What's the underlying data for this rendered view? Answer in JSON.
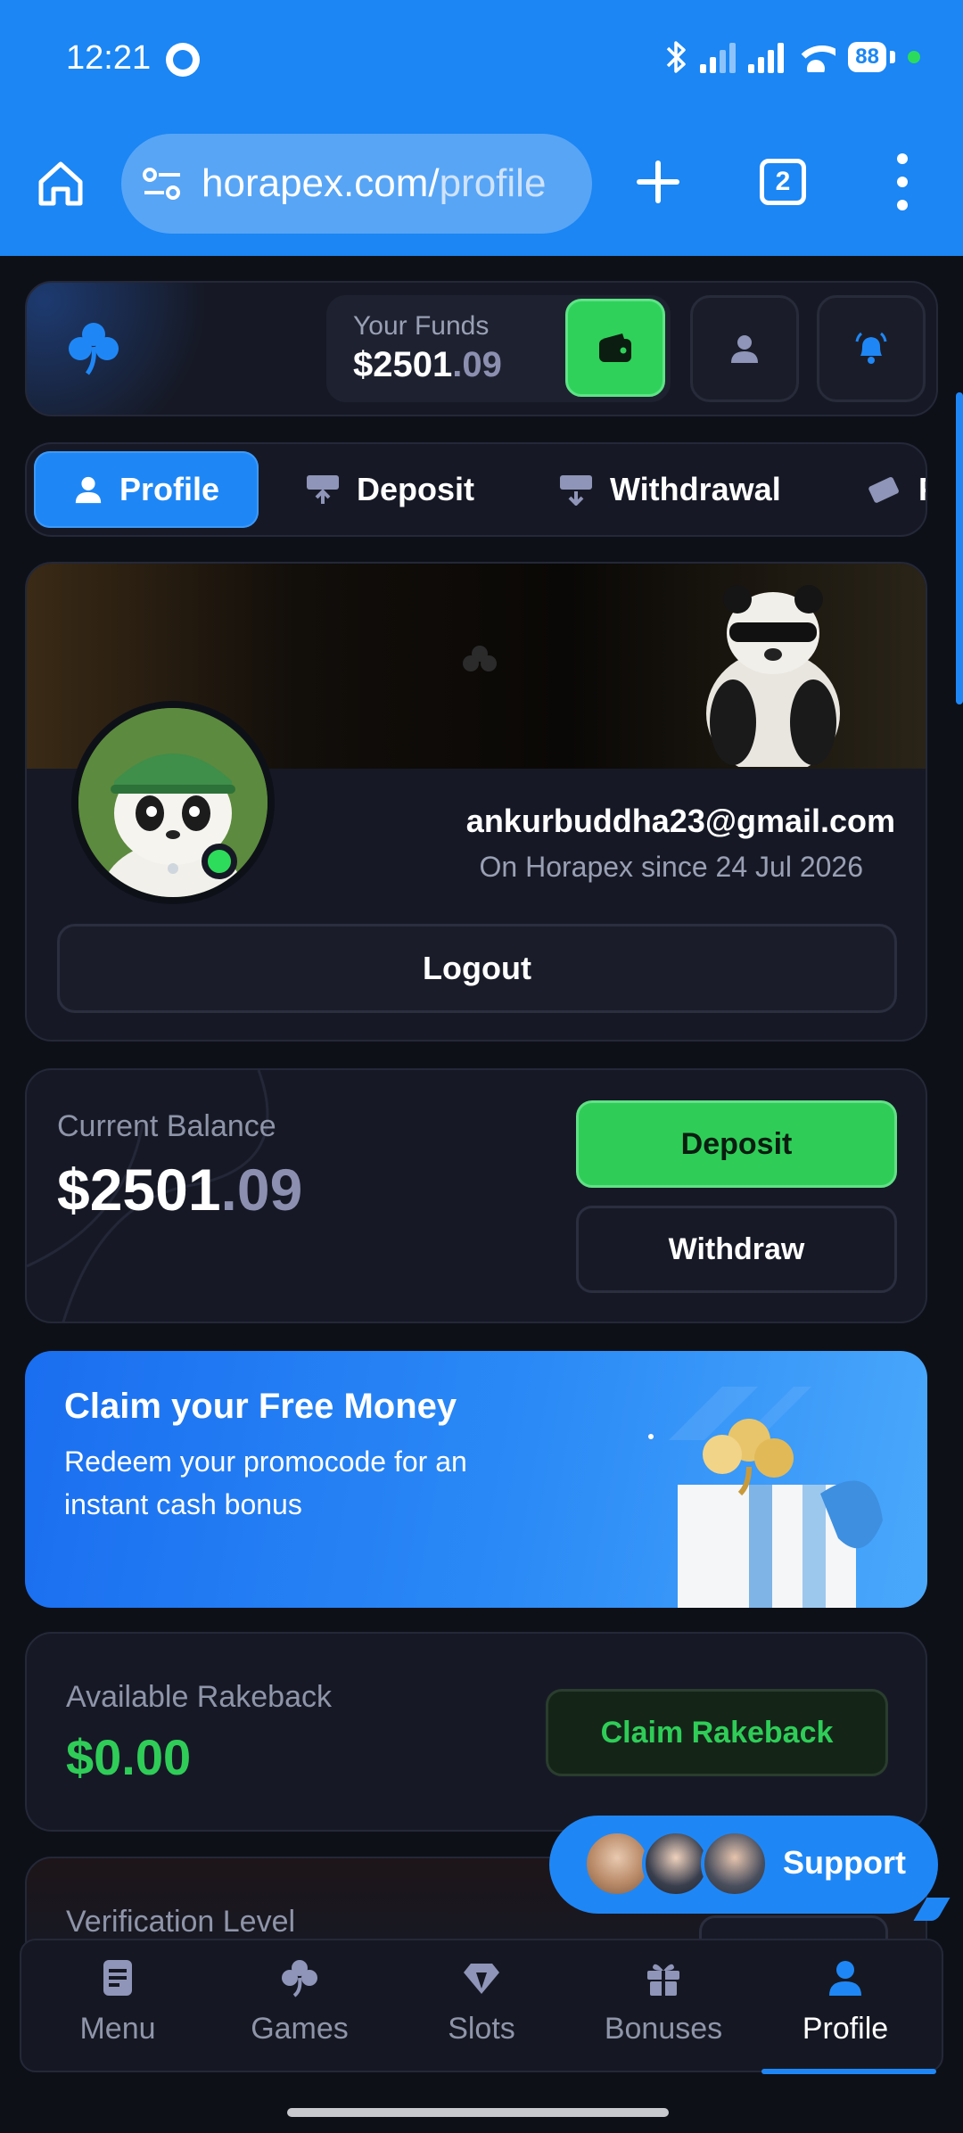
{
  "status_bar": {
    "time": "12:21",
    "battery": "88"
  },
  "browser": {
    "url_domain": "horapex.com/",
    "url_path": "profile",
    "tab_count": "2"
  },
  "header": {
    "funds_label": "Your Funds",
    "funds_whole": "$2501",
    "funds_cents": ".09"
  },
  "tabs": [
    {
      "label": "Profile"
    },
    {
      "label": "Deposit"
    },
    {
      "label": "Withdrawal"
    },
    {
      "label": "F"
    }
  ],
  "profile": {
    "email": "ankurbuddha23@gmail.com",
    "since": "On Horapex since 24 Jul 2026",
    "logout_label": "Logout"
  },
  "balance": {
    "label": "Current Balance",
    "amount_whole": "$2501",
    "amount_cents": ".09",
    "deposit_label": "Deposit",
    "withdraw_label": "Withdraw"
  },
  "promo": {
    "title": "Claim your Free Money",
    "subtitle": "Redeem your promocode for an instant cash bonus"
  },
  "rakeback": {
    "label": "Available Rakeback",
    "amount": "$0.00",
    "claim_label": "Claim Rakeback"
  },
  "verification": {
    "label": "Verification Level"
  },
  "support": {
    "label": "Support"
  },
  "bottom_nav": [
    {
      "label": "Menu",
      "icon": "menu-doc-icon"
    },
    {
      "label": "Games",
      "icon": "clover-icon"
    },
    {
      "label": "Slots",
      "icon": "diamond-icon"
    },
    {
      "label": "Bonuses",
      "icon": "gift-icon"
    },
    {
      "label": "Profile",
      "icon": "user-icon",
      "active": true
    }
  ],
  "colors": {
    "accent": "#1f87f5",
    "success": "#2fcd58",
    "background": "#0e1018",
    "card": "#161925"
  }
}
